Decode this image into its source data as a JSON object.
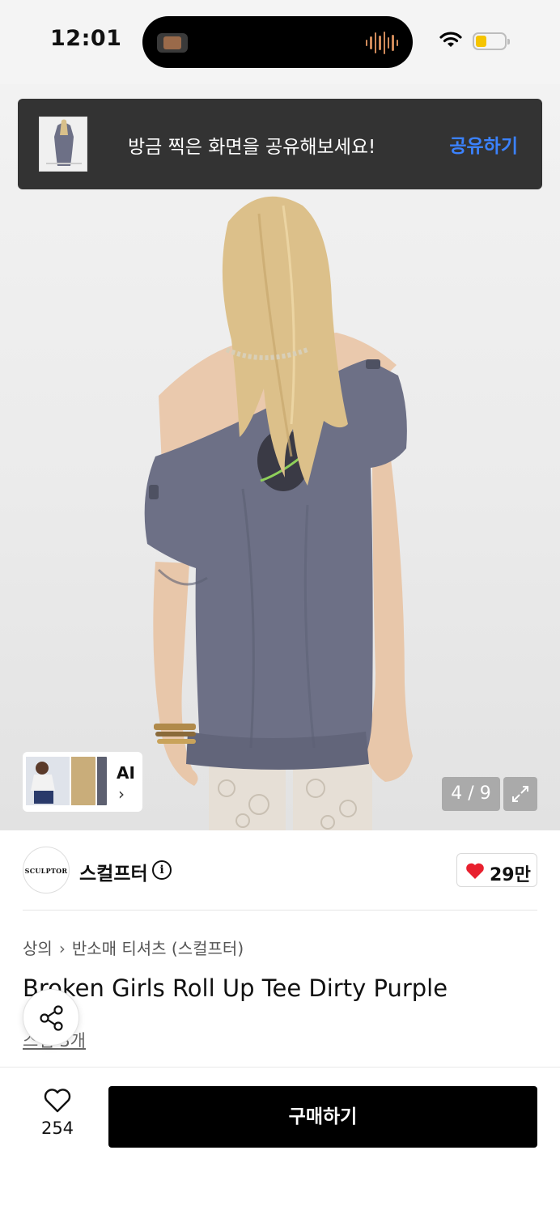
{
  "status_bar": {
    "time": "12:01"
  },
  "toast": {
    "message": "방금 찍은 화면을 공유해보세요!",
    "action": "공유하기"
  },
  "gallery": {
    "counter": "4 / 9",
    "ai_label": "AI"
  },
  "store": {
    "name": "스컬프터",
    "logo_text": "SCULPTOR",
    "likes": "29만"
  },
  "breadcrumb": {
    "category": "상의",
    "subcategory": "반소매 티셔츠 (스컬프터)"
  },
  "product": {
    "title": "Broken Girls Roll Up Tee Dirty Purple",
    "reviews": "스냅 3개"
  },
  "bottom_bar": {
    "wish_count": "254",
    "buy_label": "구매하기"
  },
  "colors": {
    "accent": "#3b82ff",
    "heart": "#e8202e",
    "toast_bg": "#333333",
    "buy_bg": "#000000",
    "shirt": "#6d7086"
  },
  "icons": [
    "wifi-icon",
    "battery-icon",
    "expand-icon",
    "info-icon",
    "heart-icon",
    "share-icon",
    "chevron-right-icon"
  ]
}
